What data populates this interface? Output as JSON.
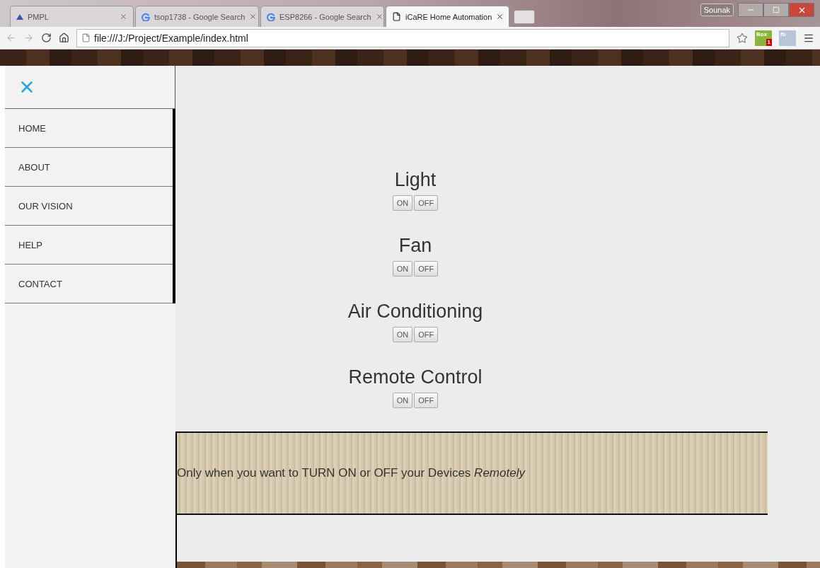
{
  "browser": {
    "tabs": [
      {
        "title": "PMPL",
        "kind": "page",
        "selected": false
      },
      {
        "title": "tsop1738 - Google Search",
        "kind": "google",
        "selected": false
      },
      {
        "title": "ESP8266 - Google Search",
        "kind": "google",
        "selected": false
      },
      {
        "title": "iCaRE Home Automation",
        "kind": "file",
        "selected": true
      }
    ],
    "user": "Sounak",
    "url": "file:///J:/Project/Example/index.html",
    "extensions": [
      {
        "label": "Box",
        "badge": "1"
      },
      {
        "label": "fb"
      }
    ]
  },
  "sidebar": {
    "items": [
      {
        "label": "HOME"
      },
      {
        "label": "ABOUT"
      },
      {
        "label": "OUR VISION"
      },
      {
        "label": "HELP"
      },
      {
        "label": "CONTACT"
      }
    ]
  },
  "devices": [
    {
      "name": "Light",
      "buttons": [
        "ON",
        "OFF"
      ]
    },
    {
      "name": "Fan",
      "buttons": [
        "ON",
        "OFF"
      ]
    },
    {
      "name": "Air Conditioning",
      "buttons": [
        "ON",
        "OFF"
      ]
    },
    {
      "name": "Remote Control",
      "buttons": [
        "ON",
        "OFF"
      ]
    }
  ],
  "banner": {
    "text": "Only when you want to TURN ON or OFF your Devices *Remotely*"
  }
}
